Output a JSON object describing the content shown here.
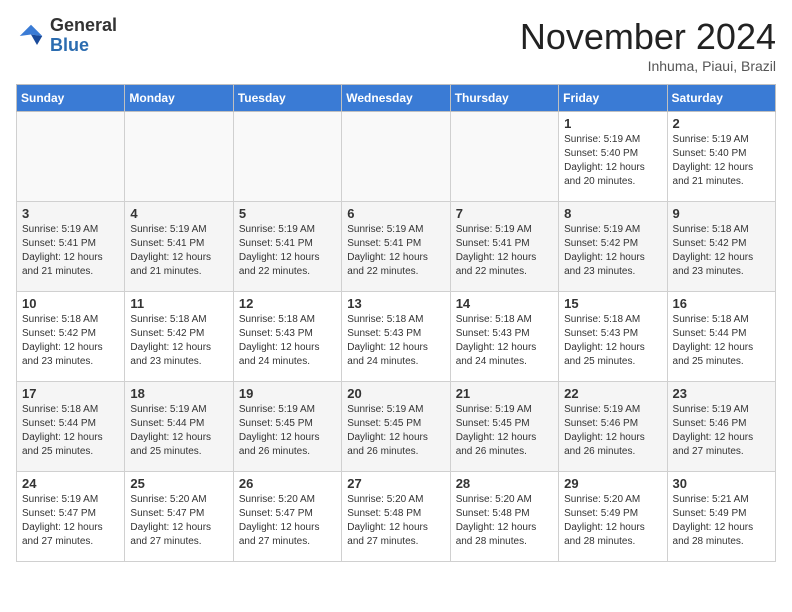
{
  "header": {
    "logo_line1": "General",
    "logo_line2": "Blue",
    "month": "November 2024",
    "location": "Inhuma, Piaui, Brazil"
  },
  "weekdays": [
    "Sunday",
    "Monday",
    "Tuesday",
    "Wednesday",
    "Thursday",
    "Friday",
    "Saturday"
  ],
  "weeks": [
    [
      {
        "day": "",
        "content": ""
      },
      {
        "day": "",
        "content": ""
      },
      {
        "day": "",
        "content": ""
      },
      {
        "day": "",
        "content": ""
      },
      {
        "day": "",
        "content": ""
      },
      {
        "day": "1",
        "content": "Sunrise: 5:19 AM\nSunset: 5:40 PM\nDaylight: 12 hours\nand 20 minutes."
      },
      {
        "day": "2",
        "content": "Sunrise: 5:19 AM\nSunset: 5:40 PM\nDaylight: 12 hours\nand 21 minutes."
      }
    ],
    [
      {
        "day": "3",
        "content": "Sunrise: 5:19 AM\nSunset: 5:41 PM\nDaylight: 12 hours\nand 21 minutes."
      },
      {
        "day": "4",
        "content": "Sunrise: 5:19 AM\nSunset: 5:41 PM\nDaylight: 12 hours\nand 21 minutes."
      },
      {
        "day": "5",
        "content": "Sunrise: 5:19 AM\nSunset: 5:41 PM\nDaylight: 12 hours\nand 22 minutes."
      },
      {
        "day": "6",
        "content": "Sunrise: 5:19 AM\nSunset: 5:41 PM\nDaylight: 12 hours\nand 22 minutes."
      },
      {
        "day": "7",
        "content": "Sunrise: 5:19 AM\nSunset: 5:41 PM\nDaylight: 12 hours\nand 22 minutes."
      },
      {
        "day": "8",
        "content": "Sunrise: 5:19 AM\nSunset: 5:42 PM\nDaylight: 12 hours\nand 23 minutes."
      },
      {
        "day": "9",
        "content": "Sunrise: 5:18 AM\nSunset: 5:42 PM\nDaylight: 12 hours\nand 23 minutes."
      }
    ],
    [
      {
        "day": "10",
        "content": "Sunrise: 5:18 AM\nSunset: 5:42 PM\nDaylight: 12 hours\nand 23 minutes."
      },
      {
        "day": "11",
        "content": "Sunrise: 5:18 AM\nSunset: 5:42 PM\nDaylight: 12 hours\nand 23 minutes."
      },
      {
        "day": "12",
        "content": "Sunrise: 5:18 AM\nSunset: 5:43 PM\nDaylight: 12 hours\nand 24 minutes."
      },
      {
        "day": "13",
        "content": "Sunrise: 5:18 AM\nSunset: 5:43 PM\nDaylight: 12 hours\nand 24 minutes."
      },
      {
        "day": "14",
        "content": "Sunrise: 5:18 AM\nSunset: 5:43 PM\nDaylight: 12 hours\nand 24 minutes."
      },
      {
        "day": "15",
        "content": "Sunrise: 5:18 AM\nSunset: 5:43 PM\nDaylight: 12 hours\nand 25 minutes."
      },
      {
        "day": "16",
        "content": "Sunrise: 5:18 AM\nSunset: 5:44 PM\nDaylight: 12 hours\nand 25 minutes."
      }
    ],
    [
      {
        "day": "17",
        "content": "Sunrise: 5:18 AM\nSunset: 5:44 PM\nDaylight: 12 hours\nand 25 minutes."
      },
      {
        "day": "18",
        "content": "Sunrise: 5:19 AM\nSunset: 5:44 PM\nDaylight: 12 hours\nand 25 minutes."
      },
      {
        "day": "19",
        "content": "Sunrise: 5:19 AM\nSunset: 5:45 PM\nDaylight: 12 hours\nand 26 minutes."
      },
      {
        "day": "20",
        "content": "Sunrise: 5:19 AM\nSunset: 5:45 PM\nDaylight: 12 hours\nand 26 minutes."
      },
      {
        "day": "21",
        "content": "Sunrise: 5:19 AM\nSunset: 5:45 PM\nDaylight: 12 hours\nand 26 minutes."
      },
      {
        "day": "22",
        "content": "Sunrise: 5:19 AM\nSunset: 5:46 PM\nDaylight: 12 hours\nand 26 minutes."
      },
      {
        "day": "23",
        "content": "Sunrise: 5:19 AM\nSunset: 5:46 PM\nDaylight: 12 hours\nand 27 minutes."
      }
    ],
    [
      {
        "day": "24",
        "content": "Sunrise: 5:19 AM\nSunset: 5:47 PM\nDaylight: 12 hours\nand 27 minutes."
      },
      {
        "day": "25",
        "content": "Sunrise: 5:20 AM\nSunset: 5:47 PM\nDaylight: 12 hours\nand 27 minutes."
      },
      {
        "day": "26",
        "content": "Sunrise: 5:20 AM\nSunset: 5:47 PM\nDaylight: 12 hours\nand 27 minutes."
      },
      {
        "day": "27",
        "content": "Sunrise: 5:20 AM\nSunset: 5:48 PM\nDaylight: 12 hours\nand 27 minutes."
      },
      {
        "day": "28",
        "content": "Sunrise: 5:20 AM\nSunset: 5:48 PM\nDaylight: 12 hours\nand 28 minutes."
      },
      {
        "day": "29",
        "content": "Sunrise: 5:20 AM\nSunset: 5:49 PM\nDaylight: 12 hours\nand 28 minutes."
      },
      {
        "day": "30",
        "content": "Sunrise: 5:21 AM\nSunset: 5:49 PM\nDaylight: 12 hours\nand 28 minutes."
      }
    ]
  ]
}
